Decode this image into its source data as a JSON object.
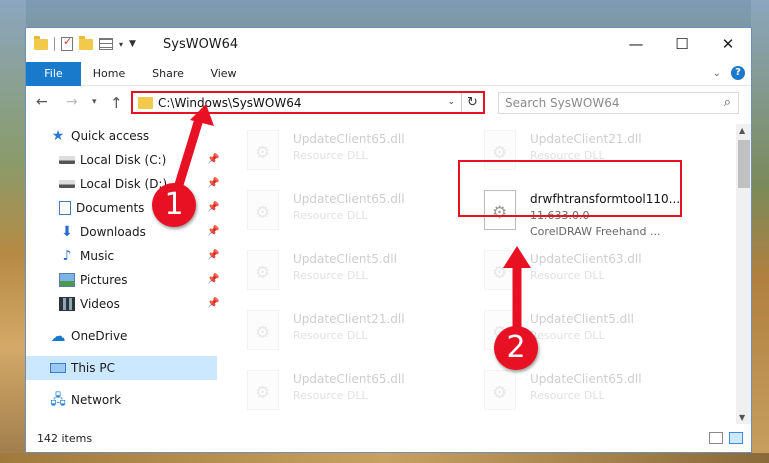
{
  "window": {
    "title": "SysWOW64",
    "controls": {
      "minimize": "—",
      "maximize": "☐",
      "close": "✕"
    }
  },
  "ribbon": {
    "tabs": [
      "File",
      "Home",
      "Share",
      "View"
    ]
  },
  "navigation": {
    "address": "C:\\Windows\\SysWOW64",
    "search_placeholder": "Search SysWOW64"
  },
  "sidebar": {
    "items": [
      {
        "label": "Quick access",
        "icon": "star-icon",
        "pinned": false
      },
      {
        "label": "Local Disk (C:)",
        "icon": "drive-icon",
        "pinned": true
      },
      {
        "label": "Local Disk (D:)",
        "icon": "drive-icon",
        "pinned": true
      },
      {
        "label": "Documents",
        "icon": "documents-icon",
        "pinned": true
      },
      {
        "label": "Downloads",
        "icon": "downloads-icon",
        "pinned": true
      },
      {
        "label": "Music",
        "icon": "music-icon",
        "pinned": true
      },
      {
        "label": "Pictures",
        "icon": "pictures-icon",
        "pinned": true
      },
      {
        "label": "Videos",
        "icon": "videos-icon",
        "pinned": true
      },
      {
        "label": "OneDrive",
        "icon": "onedrive-icon",
        "pinned": false
      },
      {
        "label": "This PC",
        "icon": "pc-icon",
        "pinned": false,
        "selected": true
      },
      {
        "label": "Network",
        "icon": "network-icon",
        "pinned": false
      }
    ]
  },
  "files": [
    {
      "name": "UpdateClient65.dll",
      "desc": "Resource DLL"
    },
    {
      "name": "UpdateClient21.dll",
      "desc": "Resource DLL"
    },
    {
      "name": "UpdateClient65.dll",
      "desc": "Resource DLL"
    },
    {
      "name": "drwfhtransformtool110...",
      "desc": "11.633.0.0",
      "desc2": "CorelDRAW Freehand ..."
    },
    {
      "name": "UpdateClient5.dll",
      "desc": "Resource DLL"
    },
    {
      "name": "UpdateClient63.dll",
      "desc": "Resource DLL"
    },
    {
      "name": "UpdateClient21.dll",
      "desc": "Resource DLL"
    },
    {
      "name": "UpdateClient5.dll",
      "desc": "Resource DLL"
    },
    {
      "name": "UpdateClient65.dll",
      "desc": "Resource DLL"
    },
    {
      "name": "UpdateClient65.dll",
      "desc": "Resource DLL"
    }
  ],
  "status": {
    "item_count": "142 items"
  },
  "annotations": {
    "step1": "1",
    "step2": "2",
    "color": "#e81123"
  }
}
